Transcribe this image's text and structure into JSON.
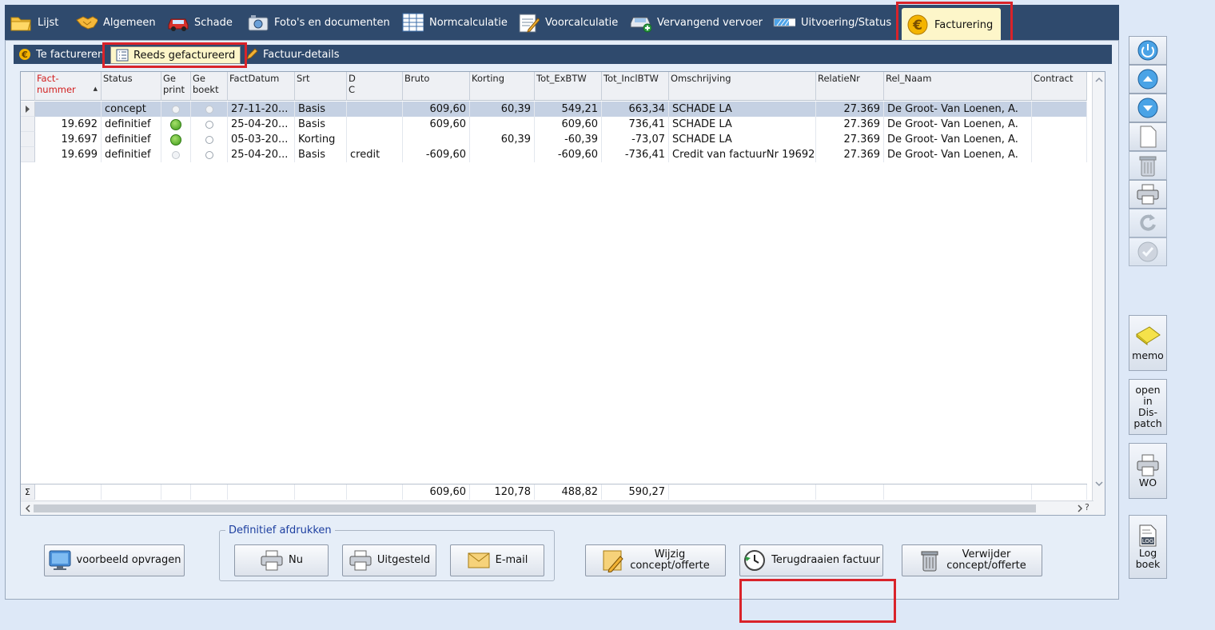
{
  "top_tabs": [
    {
      "label": "Lijst",
      "icon": "folder-icon"
    },
    {
      "label": "Algemeen",
      "icon": "handshake-icon"
    },
    {
      "label": "Schade",
      "icon": "damaged-car-icon"
    },
    {
      "label": "Foto's en documenten",
      "icon": "camera-icon"
    },
    {
      "label": "Normcalculatie",
      "icon": "calculator-sheet-icon"
    },
    {
      "label": "Voorcalculatie",
      "icon": "notepad-icon"
    },
    {
      "label": "Vervangend vervoer",
      "icon": "car-add-icon"
    },
    {
      "label": "Uitvoering/Status",
      "icon": "progress-icon"
    },
    {
      "label": "Facturering",
      "icon": "euro-icon",
      "active": true
    }
  ],
  "sub_tabs": [
    {
      "label": "Te factureren",
      "icon": "euro-icon"
    },
    {
      "label": "Reeds gefactureerd",
      "icon": "list-icon",
      "active": true
    },
    {
      "label": "Factuur-details",
      "icon": "pencil-icon"
    }
  ],
  "grid": {
    "columns": [
      {
        "key": "factnr",
        "label_line1": "Fact-",
        "label_line2": "nummer"
      },
      {
        "key": "status",
        "label_line1": "Status",
        "label_line2": ""
      },
      {
        "key": "geprint",
        "label_line1": "Ge",
        "label_line2": "print"
      },
      {
        "key": "geboekt",
        "label_line1": "Ge",
        "label_line2": "boekt"
      },
      {
        "key": "factdatum",
        "label_line1": "FactDatum",
        "label_line2": ""
      },
      {
        "key": "srt",
        "label_line1": "Srt",
        "label_line2": ""
      },
      {
        "key": "dc",
        "label_line1": "D",
        "label_line2": "C"
      },
      {
        "key": "bruto",
        "label_line1": "Bruto",
        "label_line2": ""
      },
      {
        "key": "korting",
        "label_line1": "Korting",
        "label_line2": ""
      },
      {
        "key": "exbtw",
        "label_line1": "Tot_ExBTW",
        "label_line2": ""
      },
      {
        "key": "inclbtw",
        "label_line1": "Tot_InclBTW",
        "label_line2": ""
      },
      {
        "key": "omschrijving",
        "label_line1": "Omschrijving",
        "label_line2": ""
      },
      {
        "key": "relatienr",
        "label_line1": "RelatieNr",
        "label_line2": ""
      },
      {
        "key": "relnaam",
        "label_line1": "Rel_Naam",
        "label_line2": ""
      },
      {
        "key": "contract",
        "label_line1": "Contract",
        "label_line2": ""
      }
    ],
    "rows": [
      {
        "factnr": "",
        "status": "concept",
        "geprint": "faint",
        "geboekt": "faint",
        "factdatum": "27-11-20...",
        "srt": "Basis",
        "dc": "",
        "bruto": "609,60",
        "korting": "60,39",
        "exbtw": "549,21",
        "inclbtw": "663,34",
        "omschrijving": "SCHADE LA",
        "relatienr": "27.369",
        "relnaam": "De Groot- Van Loenen, A.",
        "contract": ""
      },
      {
        "factnr": "19.692",
        "status": "definitief",
        "geprint": "green",
        "geboekt": "empty",
        "factdatum": "25-04-20...",
        "srt": "Basis",
        "dc": "",
        "bruto": "609,60",
        "korting": "",
        "exbtw": "609,60",
        "inclbtw": "736,41",
        "omschrijving": "SCHADE LA",
        "relatienr": "27.369",
        "relnaam": "De Groot- Van Loenen, A.",
        "contract": ""
      },
      {
        "factnr": "19.697",
        "status": "definitief",
        "geprint": "green",
        "geboekt": "empty",
        "factdatum": "05-03-20...",
        "srt": "Korting",
        "dc": "",
        "bruto": "",
        "korting": "60,39",
        "exbtw": "-60,39",
        "inclbtw": "-73,07",
        "omschrijving": "SCHADE LA",
        "relatienr": "27.369",
        "relnaam": "De Groot- Van Loenen, A.",
        "contract": ""
      },
      {
        "factnr": "19.699",
        "status": "definitief",
        "geprint": "faint",
        "geboekt": "empty",
        "factdatum": "25-04-20...",
        "srt": "Basis",
        "dc": "credit",
        "bruto": "-609,60",
        "korting": "",
        "exbtw": "-609,60",
        "inclbtw": "-736,41",
        "omschrijving": "Credit van factuurNr 19692",
        "relatienr": "27.369",
        "relnaam": "De Groot- Van Loenen, A.",
        "contract": ""
      }
    ],
    "totals": {
      "symbol": "Σ",
      "bruto": "609,60",
      "korting": "120,78",
      "exbtw": "488,82",
      "inclbtw": "590,27"
    },
    "scroll_hint": "?"
  },
  "buttons": {
    "preview": "voorbeeld  opvragen",
    "group_label": "Definitief afdrukken",
    "print_now": "Nu",
    "print_later": "Uitgesteld",
    "email": "E-mail",
    "edit_line1": "Wijzig",
    "edit_line2": "concept/offerte",
    "revert": "Terugdraaien factuur",
    "delete_line1": "Verwijder",
    "delete_line2": "concept/offerte"
  },
  "sidebar": {
    "memo": "memo",
    "dispatch_l1": "open",
    "dispatch_l2": "in",
    "dispatch_l3": "Dis-",
    "dispatch_l4": "patch",
    "wo": "WO",
    "log_badge": "LOG",
    "log_l1": "Log",
    "log_l2": "boek"
  },
  "colors": {
    "bar": "#2f4a6d",
    "active_tab": "#fdf6c9",
    "highlight": "#d9232a",
    "group_label": "#1d3fa0",
    "sort_header": "#d21f1f"
  }
}
